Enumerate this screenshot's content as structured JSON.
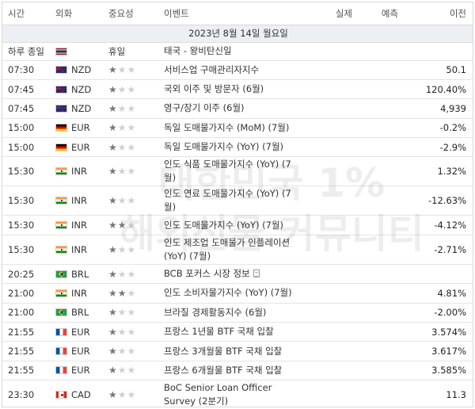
{
  "header": {
    "time": "시간",
    "currency": "외화",
    "importance": "중요성",
    "event": "이벤트",
    "actual": "실제",
    "forecast": "예측",
    "previous": "이전"
  },
  "date_label": "2023년 8월 14일 월요일",
  "holiday": {
    "time": "하루 종일",
    "flag": "thailand",
    "label": "휴일",
    "event": "태국 - 왕비탄신일"
  },
  "rows": [
    {
      "time": "07:30",
      "flag": "new-zealand",
      "currency": "NZD",
      "stars": 1,
      "event": "서비스업 구매관리자지수",
      "actual": "",
      "forecast": "",
      "previous": "50.1",
      "lines": 1,
      "doc": false
    },
    {
      "time": "07:45",
      "flag": "new-zealand",
      "currency": "NZD",
      "stars": 1,
      "event": "국외 이주 및 방문자 (6월)",
      "actual": "",
      "forecast": "",
      "previous": "120.40%",
      "lines": 1,
      "doc": false
    },
    {
      "time": "07:45",
      "flag": "new-zealand",
      "currency": "NZD",
      "stars": 1,
      "event": "영구/장기 이주 (6월)",
      "actual": "",
      "forecast": "",
      "previous": "4,939",
      "lines": 1,
      "doc": false
    },
    {
      "time": "15:00",
      "flag": "germany",
      "currency": "EUR",
      "stars": 1,
      "event": "독일 도매물가지수 (MoM) (7월)",
      "actual": "",
      "forecast": "",
      "previous": "-0.2%",
      "lines": 1,
      "doc": false
    },
    {
      "time": "15:00",
      "flag": "germany",
      "currency": "EUR",
      "stars": 1,
      "event": "독일 도매물가지수 (YoY) (7월)",
      "actual": "",
      "forecast": "",
      "previous": "-2.9%",
      "lines": 1,
      "doc": false
    },
    {
      "time": "15:30",
      "flag": "india",
      "currency": "INR",
      "stars": 1,
      "event": "인도 식품 도매물가지수 (YoY) (7월)",
      "actual": "",
      "forecast": "",
      "previous": "1.32%",
      "lines": 2,
      "doc": false
    },
    {
      "time": "15:30",
      "flag": "india",
      "currency": "INR",
      "stars": 1,
      "event": "인도 연료 도매물가지수 (YoY) (7월)",
      "actual": "",
      "forecast": "",
      "previous": "-12.63%",
      "lines": 2,
      "doc": false
    },
    {
      "time": "15:30",
      "flag": "india",
      "currency": "INR",
      "stars": 2,
      "event": "인도 도매물가지수 (YoY) (7월)",
      "actual": "",
      "forecast": "",
      "previous": "-4.12%",
      "lines": 1,
      "doc": false
    },
    {
      "time": "15:30",
      "flag": "india",
      "currency": "INR",
      "stars": 1,
      "event": "인도 제조업 도매물가 인플레이션 (YoY) (7월)",
      "actual": "",
      "forecast": "",
      "previous": "-2.71%",
      "lines": 2,
      "doc": false
    },
    {
      "time": "20:25",
      "flag": "brazil",
      "currency": "BRL",
      "stars": 1,
      "event": "BCB 포커스 시장 정보",
      "actual": "",
      "forecast": "",
      "previous": "",
      "lines": 1,
      "doc": true
    },
    {
      "time": "21:00",
      "flag": "india",
      "currency": "INR",
      "stars": 2,
      "event": "인도 소비자물가지수 (YoY) (7월)",
      "actual": "",
      "forecast": "",
      "previous": "4.81%",
      "lines": 1,
      "doc": false
    },
    {
      "time": "21:00",
      "flag": "brazil",
      "currency": "BRL",
      "stars": 1,
      "event": "브라질 경제활동지수 (6월)",
      "actual": "",
      "forecast": "",
      "previous": "-2.00%",
      "lines": 1,
      "doc": false
    },
    {
      "time": "21:55",
      "flag": "france",
      "currency": "EUR",
      "stars": 1,
      "event": "프랑스 1년물 BTF 국채 입찰",
      "actual": "",
      "forecast": "",
      "previous": "3.574%",
      "lines": 1,
      "doc": false
    },
    {
      "time": "21:55",
      "flag": "france",
      "currency": "EUR",
      "stars": 1,
      "event": "프랑스 3개월물 BTF 국채 입찰",
      "actual": "",
      "forecast": "",
      "previous": "3.617%",
      "lines": 1,
      "doc": false
    },
    {
      "time": "21:55",
      "flag": "france",
      "currency": "EUR",
      "stars": 1,
      "event": "프랑스 6개월물 BTF 국채 입찰",
      "actual": "",
      "forecast": "",
      "previous": "3.585%",
      "lines": 1,
      "doc": false
    },
    {
      "time": "23:30",
      "flag": "canada",
      "currency": "CAD",
      "stars": 1,
      "event": "BoC Senior Loan Officer Survey (2분기)",
      "actual": "",
      "forecast": "",
      "previous": "11.3",
      "lines": 2,
      "doc": false
    }
  ],
  "watermark": {
    "line1": "대한민국 1%",
    "line2": "해외선물 커뮤니티"
  }
}
